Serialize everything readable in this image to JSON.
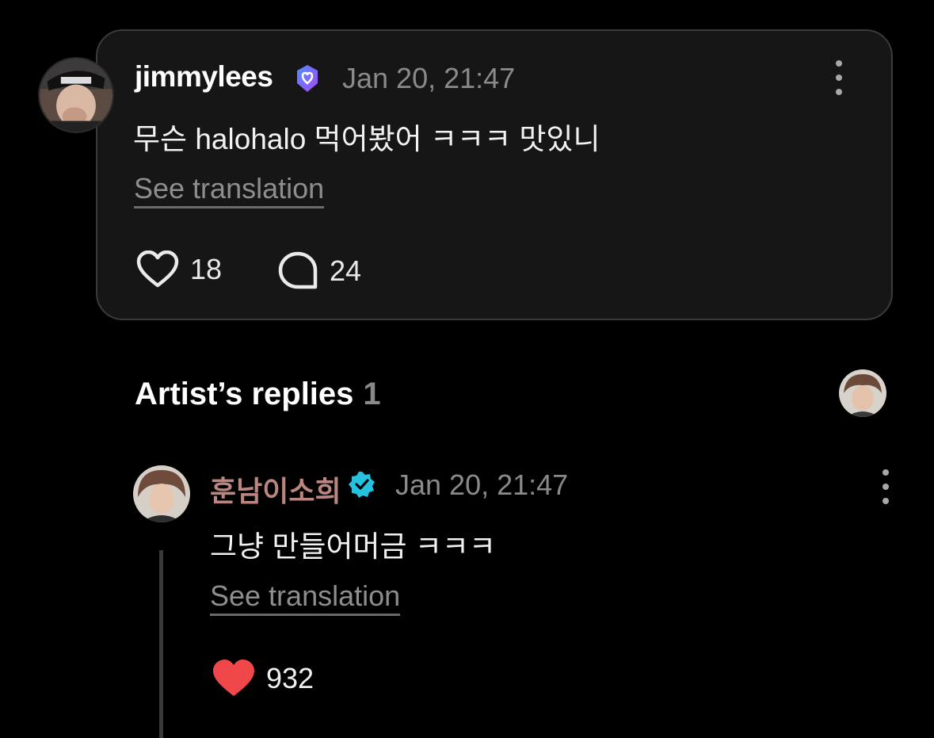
{
  "post": {
    "username": "jimmylees",
    "timestamp": "Jan 20, 21:47",
    "body": "무슨 halohalo 먹어봤어 ㅋㅋㅋ 맛있니",
    "see_translation": "See translation",
    "likes": "18",
    "comments": "24",
    "badge_color": "#7b6cf6"
  },
  "artist_replies": {
    "title": "Artist’s replies",
    "count": "1"
  },
  "reply": {
    "username": "훈남이소희",
    "timestamp": "Jan 20, 21:47",
    "body": "그냥 만들어머금 ㅋㅋㅋ",
    "see_translation": "See translation",
    "likes": "932",
    "name_color": "#b98780",
    "badge_color": "#25c2e0",
    "heart_color": "#f0474a"
  }
}
